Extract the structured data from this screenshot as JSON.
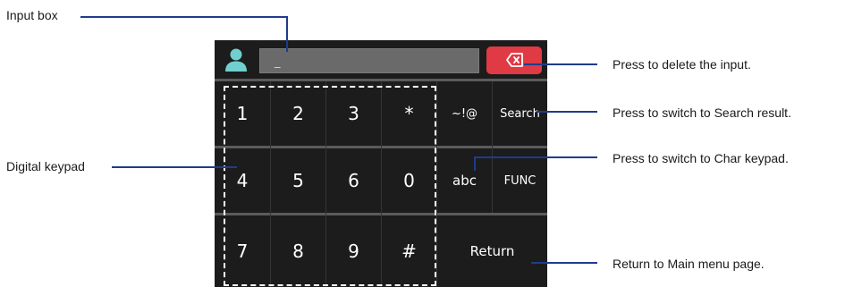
{
  "callouts": {
    "input_box": "Input box",
    "digital_keypad": "Digital keypad",
    "delete": "Press to delete the input.",
    "search": "Press to switch to Search result.",
    "char": "Press to switch to Char keypad.",
    "return": "Return to Main menu page."
  },
  "input": {
    "value": "_"
  },
  "keys": {
    "row1": [
      "1",
      "2",
      "3",
      "*",
      "~!@",
      "Search"
    ],
    "row2": [
      "4",
      "5",
      "6",
      "0",
      "abc",
      "FUNC"
    ],
    "row3": [
      "7",
      "8",
      "9",
      "#",
      "Return"
    ]
  },
  "icons": {
    "user": "user-icon",
    "delete": "backspace-icon"
  },
  "colors": {
    "accent_line": "#1f3c8c",
    "delete_button": "#e03a45",
    "panel": "#1c1c1c"
  }
}
